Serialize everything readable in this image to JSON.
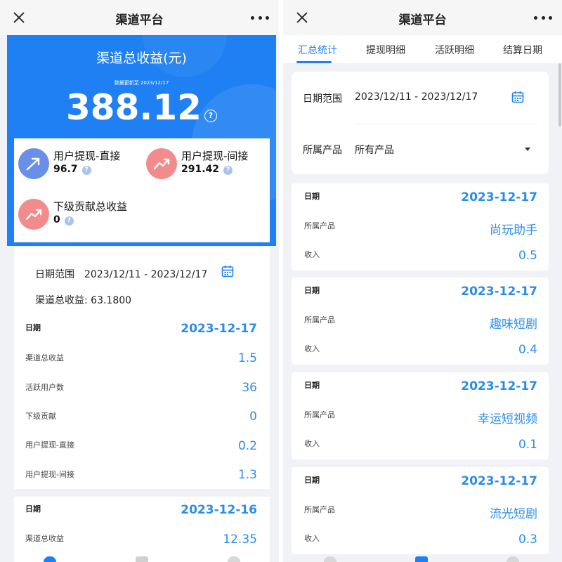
{
  "left": {
    "titlebar": {
      "title": "渠道平台"
    },
    "hero": {
      "title": "渠道总收益(元)",
      "update_text": "数据更新至 2023/12/17",
      "amount": "388.12",
      "help_glyph": "?"
    },
    "stats": [
      {
        "label": "用户提现-直接",
        "value": "96.7",
        "icon": "arrow-up-right-icon",
        "color": "#6a8fe8"
      },
      {
        "label": "用户提现-间接",
        "value": "291.42",
        "icon": "trend-up-icon",
        "color": "#f28b8b"
      },
      {
        "label": "下级贡献总收益",
        "value": "0",
        "icon": "trend-up-icon",
        "color": "#f28b8b"
      }
    ],
    "filter": {
      "date_label": "日期范围",
      "date_value": "2023/12/11 - 2023/12/17",
      "total_text": "渠道总收益: 63.1800"
    },
    "day1": {
      "rows": [
        {
          "label": "日期",
          "value": "2023-12-17"
        },
        {
          "label": "渠道总收益",
          "value": "1.5"
        },
        {
          "label": "活跃用户数",
          "value": "36"
        },
        {
          "label": "下级贡献",
          "value": "0"
        },
        {
          "label": "用户提现-直接",
          "value": "0.2"
        },
        {
          "label": "用户提现-间接",
          "value": "1.3"
        }
      ]
    },
    "day2": {
      "rows": [
        {
          "label": "日期",
          "value": "2023-12-16"
        },
        {
          "label": "渠道总收益",
          "value": "12.35"
        }
      ]
    }
  },
  "right": {
    "titlebar": {
      "title": "渠道平台"
    },
    "tabs": [
      {
        "label": "汇总统计",
        "active": true
      },
      {
        "label": "提现明细",
        "active": false
      },
      {
        "label": "活跃明细",
        "active": false
      },
      {
        "label": "结算日期",
        "active": false
      }
    ],
    "filter": {
      "date_label": "日期范围",
      "date_value": "2023/12/11 - 2023/12/17",
      "product_label": "所属产品",
      "product_value": "所有产品"
    },
    "records": [
      {
        "date_label": "日期",
        "date": "2023-12-17",
        "product_label": "所属产品",
        "product": "尚玩助手",
        "income_label": "收入",
        "income": "0.5"
      },
      {
        "date_label": "日期",
        "date": "2023-12-17",
        "product_label": "所属产品",
        "product": "趣味短剧",
        "income_label": "收入",
        "income": "0.4"
      },
      {
        "date_label": "日期",
        "date": "2023-12-17",
        "product_label": "所属产品",
        "product": "幸运短视频",
        "income_label": "收入",
        "income": "0.1"
      },
      {
        "date_label": "日期",
        "date": "2023-12-17",
        "product_label": "所属产品",
        "product": "流光短剧",
        "income_label": "收入",
        "income": "0.3"
      }
    ]
  },
  "colors": {
    "brand_blue": "#1e80f2",
    "value_blue": "#2c8de8",
    "page_bg": "#f1f2f6"
  }
}
